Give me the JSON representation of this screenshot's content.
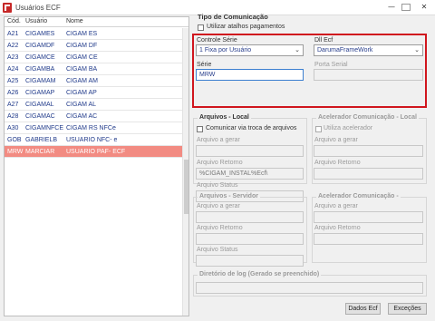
{
  "window": {
    "title": "Usuários ECF",
    "minimize": "—",
    "close": "✕"
  },
  "grid": {
    "columns": [
      "Cód.",
      "Usuário",
      "Nome"
    ],
    "rows": [
      [
        "A21",
        "CIGAMES",
        "CIGAM ES"
      ],
      [
        "A22",
        "CIGAMDF",
        "CIGAM DF"
      ],
      [
        "A23",
        "CIGAMCE",
        "CIGAM CE"
      ],
      [
        "A24",
        "CIGAMBA",
        "CIGAM BA"
      ],
      [
        "A25",
        "CIGAMAM",
        "CIGAM AM"
      ],
      [
        "A26",
        "CIGAMAP",
        "CIGAM AP"
      ],
      [
        "A27",
        "CIGAMAL",
        "CIGAM AL"
      ],
      [
        "A28",
        "CIGAMAC",
        "CIGAM AC"
      ],
      [
        "A30",
        "CIGAMNFCE",
        "CIGAM RS NFCe"
      ],
      [
        "GOB",
        "GABRIELB",
        "USUARIO NFC- e"
      ],
      [
        "MRW",
        "MARCIAR",
        "USUARIO PAF- ECF"
      ]
    ],
    "selected_index": 10
  },
  "tipo": {
    "label": "Tipo de Comunicação",
    "atalhos_label": "Utilizar atalhos pagamentos",
    "controle_serie_label": "Controle Série",
    "controle_serie_value": "1 Fixa por Usuário",
    "dll_label": "Dll Ecf",
    "dll_value": "DarumaFrameWork",
    "serie_label": "Série",
    "serie_value": "MRW",
    "porta_label": "Porta Serial",
    "porta_value": ""
  },
  "arquivos_local": {
    "title": "Arquivos - Local",
    "comunicar_label": "Comunicar via troca de arquivos",
    "gerar_label": "Arquivo a gerar",
    "gerar_value": "",
    "retorno_label": "Arquivo Retorno",
    "retorno_value": "%CIGAM_INSTAL%Ecf\\",
    "status_label": "Arquivo Status",
    "status_value": ""
  },
  "acelerador_local": {
    "title": "Acelerador Comunicação - Local",
    "utiliza_label": "Utiliza acelerador",
    "gerar_label": "Arquivo a gerar",
    "retorno_label": "Arquivo Retorno"
  },
  "arquivos_servidor": {
    "title": "Arquivos - Servidor",
    "gerar_label": "Arquivo a gerar",
    "retorno_label": "Arquivo Retorno",
    "status_label": "Arquivo Status"
  },
  "acelerador_servidor": {
    "title": "Acelerador Comunicação -",
    "gerar_label": "Arquivo a gerar",
    "retorno_label": "Arquivo Retorno"
  },
  "diretorio": {
    "title": "Diretório de log (Gerado se preenchido)"
  },
  "buttons": {
    "dados": "Dados Ecf",
    "excecoes": "Exceções"
  },
  "colors": {
    "selected_row": "#f28b82",
    "highlight_box": "#d0161e",
    "value_text": "#283e8c"
  }
}
